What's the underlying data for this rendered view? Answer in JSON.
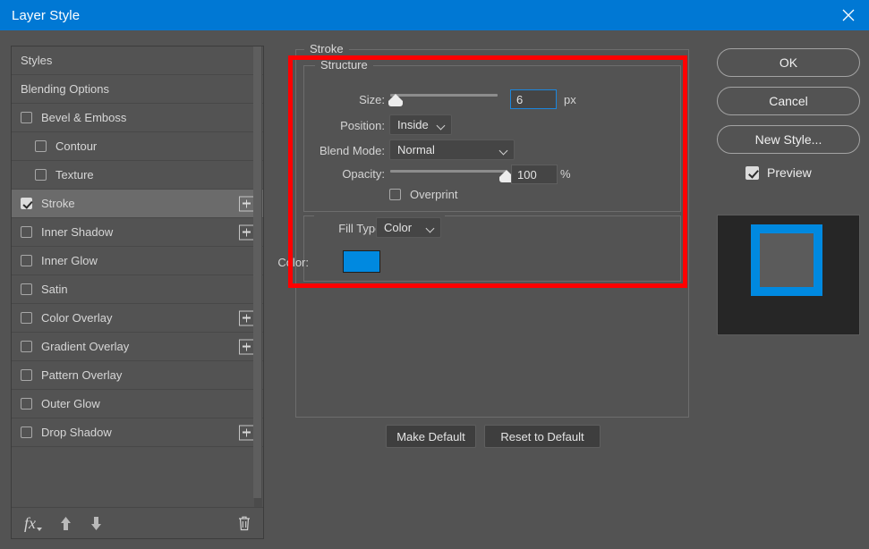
{
  "window": {
    "title": "Layer Style",
    "close_icon": "close-icon",
    "titlebar_color": "#0078d4"
  },
  "sidebar": {
    "items": [
      {
        "label": "Styles",
        "checkbox": false,
        "checked": false,
        "indent": false,
        "selected": false,
        "plus": false
      },
      {
        "label": "Blending Options",
        "checkbox": false,
        "checked": false,
        "indent": false,
        "selected": false,
        "plus": false
      },
      {
        "label": "Bevel & Emboss",
        "checkbox": true,
        "checked": false,
        "indent": false,
        "selected": false,
        "plus": false
      },
      {
        "label": "Contour",
        "checkbox": true,
        "checked": false,
        "indent": true,
        "selected": false,
        "plus": false
      },
      {
        "label": "Texture",
        "checkbox": true,
        "checked": false,
        "indent": true,
        "selected": false,
        "plus": false
      },
      {
        "label": "Stroke",
        "checkbox": true,
        "checked": true,
        "indent": false,
        "selected": true,
        "plus": true
      },
      {
        "label": "Inner Shadow",
        "checkbox": true,
        "checked": false,
        "indent": false,
        "selected": false,
        "plus": true
      },
      {
        "label": "Inner Glow",
        "checkbox": true,
        "checked": false,
        "indent": false,
        "selected": false,
        "plus": false
      },
      {
        "label": "Satin",
        "checkbox": true,
        "checked": false,
        "indent": false,
        "selected": false,
        "plus": false
      },
      {
        "label": "Color Overlay",
        "checkbox": true,
        "checked": false,
        "indent": false,
        "selected": false,
        "plus": true
      },
      {
        "label": "Gradient Overlay",
        "checkbox": true,
        "checked": false,
        "indent": false,
        "selected": false,
        "plus": true
      },
      {
        "label": "Pattern Overlay",
        "checkbox": true,
        "checked": false,
        "indent": false,
        "selected": false,
        "plus": false
      },
      {
        "label": "Outer Glow",
        "checkbox": true,
        "checked": false,
        "indent": false,
        "selected": false,
        "plus": false
      },
      {
        "label": "Drop Shadow",
        "checkbox": true,
        "checked": false,
        "indent": false,
        "selected": false,
        "plus": true
      }
    ],
    "toolbar": {
      "fx_icon": "fx-icon",
      "move_up_icon": "arrow-up-icon",
      "move_down_icon": "arrow-down-icon",
      "delete_icon": "trash-icon"
    }
  },
  "stroke_panel": {
    "legend": "Stroke",
    "structure": {
      "legend": "Structure",
      "size": {
        "label": "Size:",
        "value": "6",
        "unit": "px",
        "slider_percent": 4,
        "focused": true
      },
      "position": {
        "label": "Position:",
        "value": "Inside"
      },
      "blend_mode": {
        "label": "Blend Mode:",
        "value": "Normal"
      },
      "opacity": {
        "label": "Opacity:",
        "value": "100",
        "unit": "%",
        "slider_percent": 100
      },
      "overprint": {
        "label": "Overprint",
        "checked": false
      }
    },
    "fill": {
      "fill_type": {
        "label": "Fill Type:",
        "value": "Color"
      },
      "color": {
        "label": "Color:",
        "value": "#0089e0"
      }
    },
    "make_default": "Make Default",
    "reset_to_default": "Reset to Default"
  },
  "actions": {
    "ok": "OK",
    "cancel": "Cancel",
    "new_style": "New Style...",
    "preview": {
      "label": "Preview",
      "checked": true
    }
  },
  "preview_thumbnail": {
    "stroke_color": "#0089e0",
    "fill_color": "#5b5b5b",
    "background_color": "#262626",
    "stroke_width_px": 10
  },
  "annotation": {
    "color": "#ff0000",
    "shape": "rectangle"
  }
}
